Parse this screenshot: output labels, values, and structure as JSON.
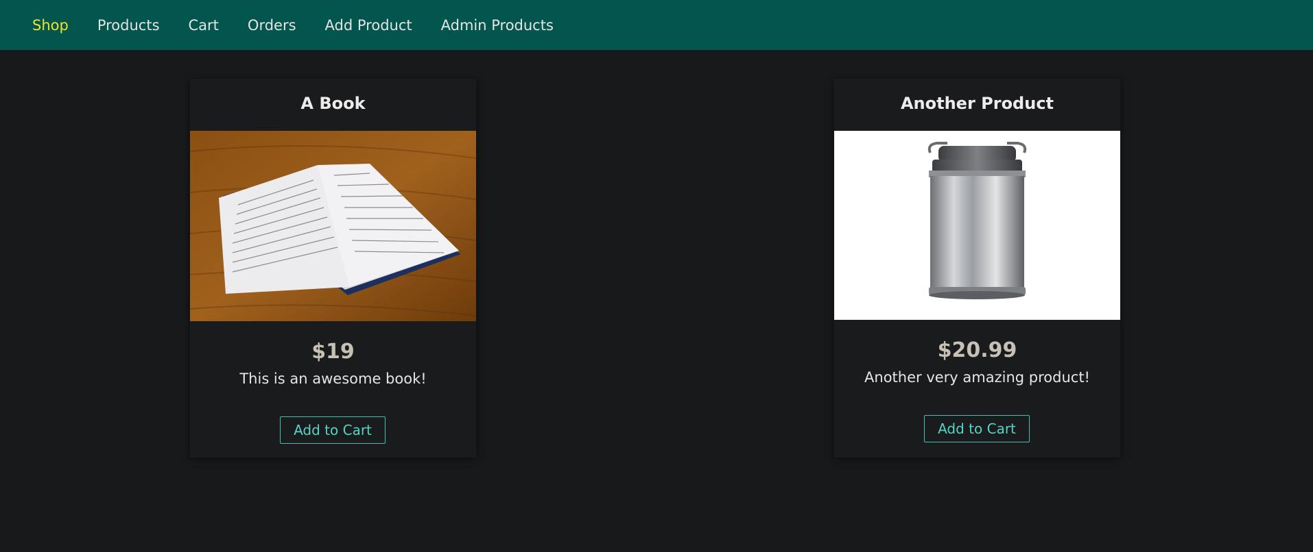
{
  "nav": {
    "items": [
      {
        "label": "Shop",
        "active": true
      },
      {
        "label": "Products",
        "active": false
      },
      {
        "label": "Cart",
        "active": false
      },
      {
        "label": "Orders",
        "active": false
      },
      {
        "label": "Add Product",
        "active": false
      },
      {
        "label": "Admin Products",
        "active": false
      }
    ]
  },
  "products": [
    {
      "title": "A Book",
      "image": "open-book-photo",
      "price": "$19",
      "description": "This is an awesome book!",
      "button_label": "Add to Cart"
    },
    {
      "title": "Another Product",
      "image": "metal-milk-can-photo",
      "price": "$20.99",
      "description": "Another very amazing product!",
      "button_label": "Add to Cart"
    }
  ],
  "colors": {
    "header_bg": "#02564d",
    "page_bg": "#18191b",
    "active_nav": "#f0e12c",
    "button_accent": "#56d5c4"
  }
}
